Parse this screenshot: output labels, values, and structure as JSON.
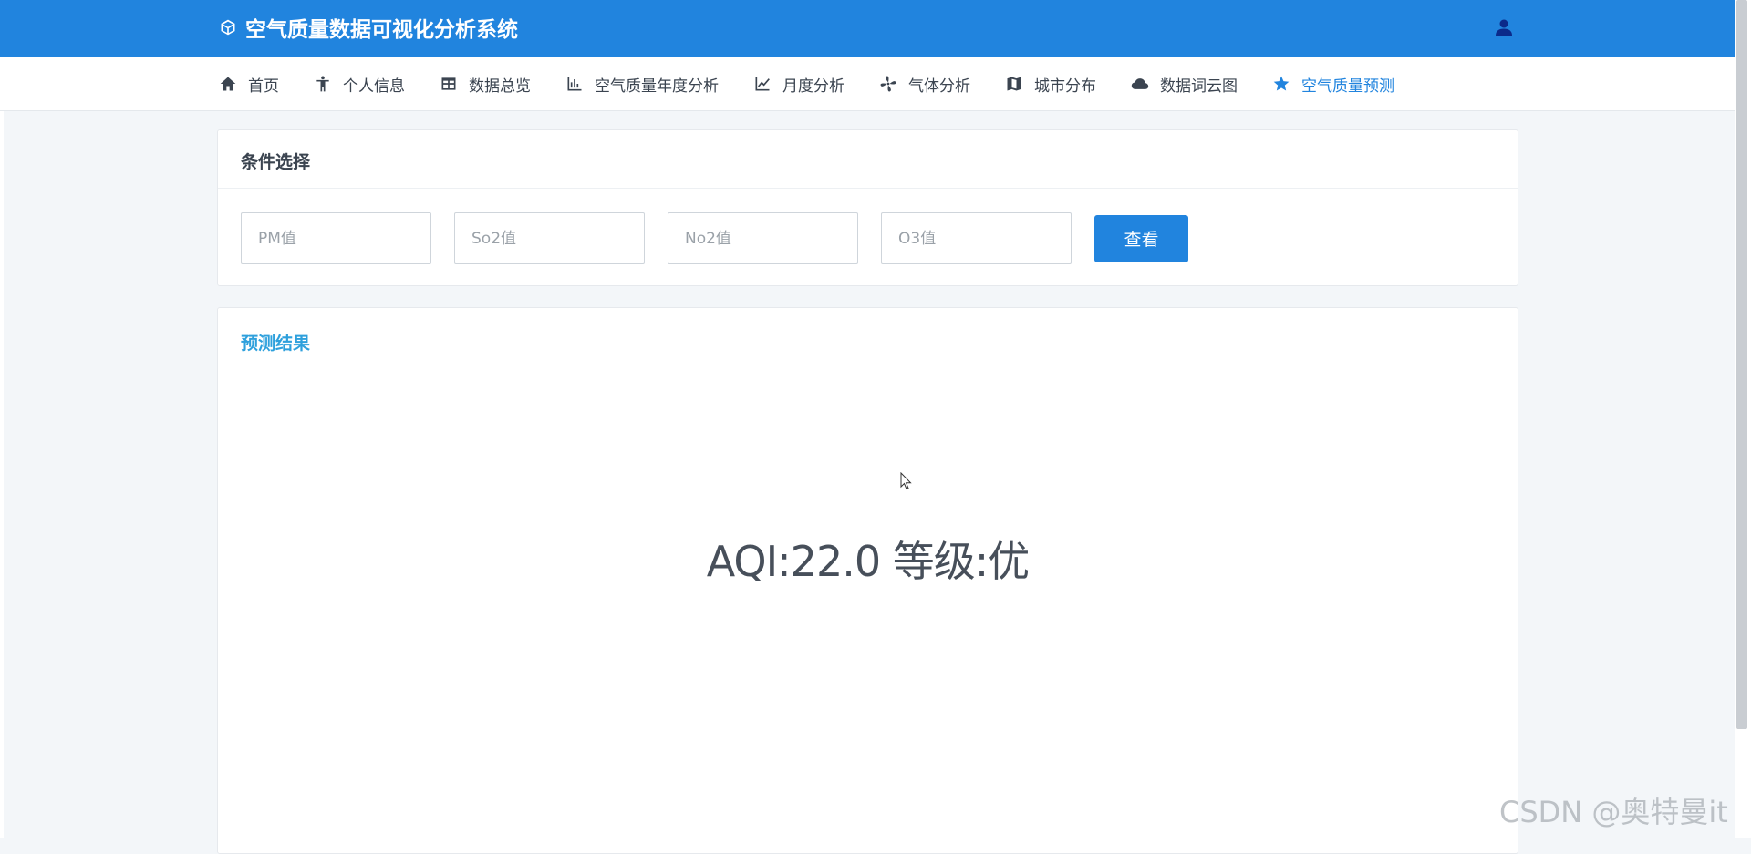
{
  "app": {
    "title": "空气质量数据可视化分析系统",
    "brand_icon": "cube-icon",
    "user_icon": "user-icon"
  },
  "colors": {
    "header_bg": "#2184de",
    "accent": "#2184de",
    "result_title": "#2ea0dc",
    "page_bg": "#f3f6f9"
  },
  "nav": {
    "items": [
      {
        "label": "首页",
        "icon": "home-icon",
        "active": false
      },
      {
        "label": "个人信息",
        "icon": "person-icon",
        "active": false
      },
      {
        "label": "数据总览",
        "icon": "table-icon",
        "active": false
      },
      {
        "label": "空气质量年度分析",
        "icon": "bar-chart-icon",
        "active": false
      },
      {
        "label": "月度分析",
        "icon": "line-chart-icon",
        "active": false
      },
      {
        "label": "气体分析",
        "icon": "fan-icon",
        "active": false
      },
      {
        "label": "城市分布",
        "icon": "map-icon",
        "active": false
      },
      {
        "label": "数据词云图",
        "icon": "cloud-icon",
        "active": false
      },
      {
        "label": "空气质量预测",
        "icon": "star-icon",
        "active": true
      }
    ]
  },
  "conditions": {
    "title": "条件选择",
    "fields": [
      {
        "placeholder": "PM值",
        "value": ""
      },
      {
        "placeholder": "So2值",
        "value": ""
      },
      {
        "placeholder": "No2值",
        "value": ""
      },
      {
        "placeholder": "O3值",
        "value": ""
      }
    ],
    "button_label": "查看"
  },
  "result": {
    "title": "预测结果",
    "text": "AQI:22.0 等级:优"
  },
  "watermark": "CSDN @奥特曼it"
}
